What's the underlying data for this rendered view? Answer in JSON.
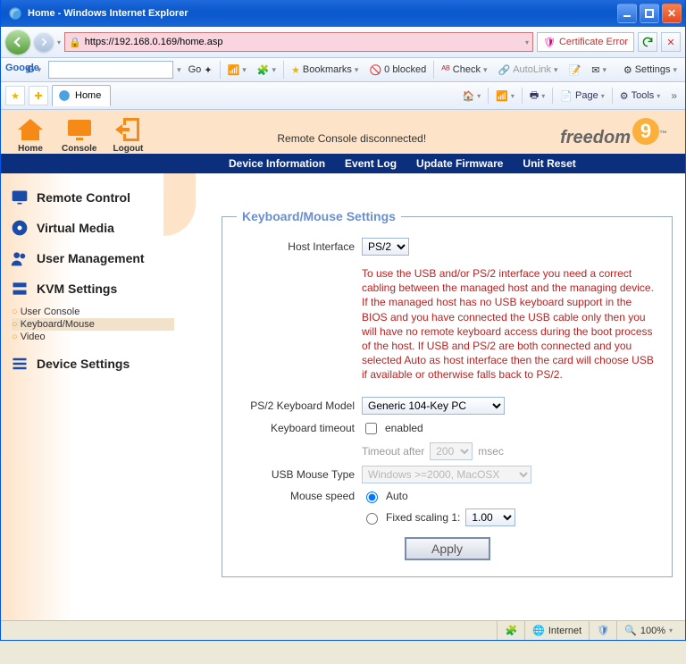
{
  "window": {
    "title": "Home - Windows Internet Explorer"
  },
  "address": {
    "url": "https://192.168.0.169/home.asp",
    "cert_error": "Certificate Error"
  },
  "google_toolbar": {
    "go": "Go",
    "bookmarks": "Bookmarks",
    "blocked_count": "0 blocked",
    "check": "Check",
    "autolink": "AutoLink",
    "settings": "Settings"
  },
  "tab": {
    "title": "Home"
  },
  "command_bar": {
    "page": "Page",
    "tools": "Tools"
  },
  "app_header": {
    "home": "Home",
    "console": "Console",
    "logout": "Logout",
    "disconnect_msg": "Remote Console disconnected!",
    "logo_text": "freedom",
    "logo_digit": "9"
  },
  "topnav": {
    "a": "Device Information",
    "b": "Event Log",
    "c": "Update Firmware",
    "d": "Unit Reset"
  },
  "sidebar": {
    "remote_control": "Remote Control",
    "virtual_media": "Virtual Media",
    "user_mgmt": "User Management",
    "kvm_settings": "KVM Settings",
    "kvm_sub": {
      "a": "User Console",
      "b": "Keyboard/Mouse",
      "c": "Video"
    },
    "device_settings": "Device Settings"
  },
  "form": {
    "legend": "Keyboard/Mouse Settings",
    "host_interface_label": "Host Interface",
    "host_interface_value": "PS/2",
    "info_text": "To use the USB and/or PS/2 interface you need a correct cabling between the managed host and the managing device. If the managed host has no USB keyboard support in the BIOS and you have connected the USB cable only then you will have no remote keyboard access during the boot process of the host. If USB and PS/2 are both connected and you selected Auto as host interface then the card will choose USB if available or otherwise falls back to PS/2.",
    "kb_model_label": "PS/2 Keyboard Model",
    "kb_model_value": "Generic 104-Key PC",
    "kb_timeout_label": "Keyboard timeout",
    "kb_timeout_enabled": "enabled",
    "timeout_after": "Timeout after",
    "timeout_value": "200",
    "timeout_unit": "msec",
    "usb_mouse_label": "USB Mouse Type",
    "usb_mouse_value": "Windows >=2000, MacOSX",
    "mouse_speed_label": "Mouse speed",
    "mouse_speed_auto": "Auto",
    "mouse_speed_fixed": "Fixed scaling 1:",
    "mouse_speed_fixed_value": "1.00",
    "apply": "Apply"
  },
  "status": {
    "zone": "Internet",
    "zoom": "100%"
  }
}
